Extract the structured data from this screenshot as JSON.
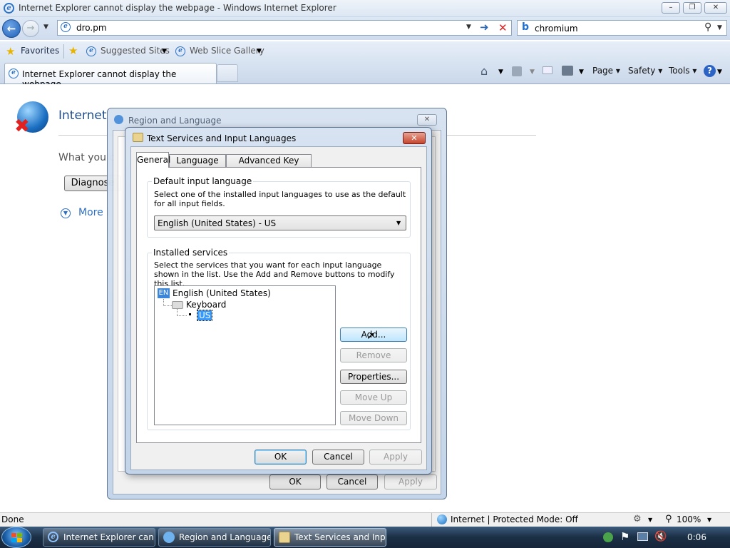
{
  "browser": {
    "window_title": "Internet Explorer cannot display the webpage - Windows Internet Explorer",
    "address": "dro.pm",
    "search_value": "chromium",
    "favorites_label": "Favorites",
    "suggested_sites": "Suggested Sites",
    "web_slice_gallery": "Web Slice Gallery",
    "tab_title": "Internet Explorer cannot display the webpage",
    "commands": {
      "page": "Page",
      "safety": "Safety",
      "tools": "Tools"
    }
  },
  "error_page": {
    "heading": "Internet",
    "question": "What you c",
    "diagnose_button": "Diagnose",
    "more_info": "More i"
  },
  "region_dialog": {
    "title": "Region and Language",
    "ok": "OK",
    "cancel": "Cancel",
    "apply": "Apply"
  },
  "text_services_dialog": {
    "title": "Text Services and Input Languages",
    "tabs": [
      "General",
      "Language Bar",
      "Advanced Key Settings"
    ],
    "default_group": {
      "label": "Default input language",
      "description": "Select one of the installed input languages to use as the default for all input fields.",
      "selected": "English (United States) - US"
    },
    "installed_group": {
      "label": "Installed services",
      "description": "Select the services that you want for each input language shown in the list. Use the Add and Remove buttons to modify this list.",
      "tree": {
        "lang_badge": "EN",
        "language": "English (United States)",
        "category": "Keyboard",
        "layout": "US"
      },
      "buttons": {
        "add": "Add...",
        "remove": "Remove",
        "properties": "Properties...",
        "move_up": "Move Up",
        "move_down": "Move Down"
      }
    },
    "ok": "OK",
    "cancel": "Cancel",
    "apply": "Apply"
  },
  "status_bar": {
    "left": "Done",
    "zone": "Internet | Protected Mode: Off",
    "zoom": "100%"
  },
  "taskbar": {
    "items": [
      "Internet Explorer can...",
      "Region and Language",
      "Text Services and Inp..."
    ],
    "clock": "0:06"
  }
}
